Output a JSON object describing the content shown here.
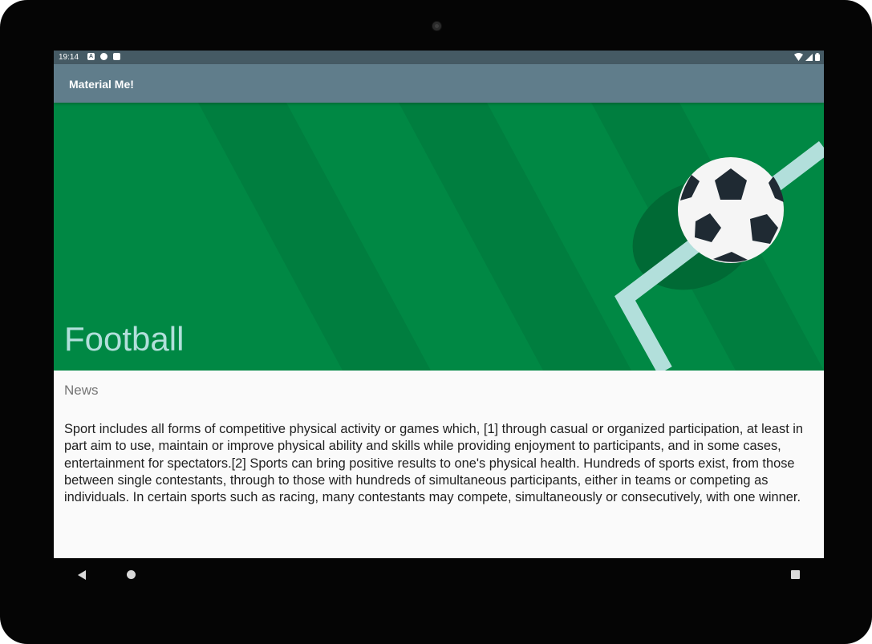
{
  "status_bar": {
    "time": "19:14",
    "left_icons": [
      "a-icon",
      "sync-icon",
      "sd-card-icon"
    ],
    "right_icons": [
      "wifi-icon",
      "cell-signal-icon",
      "battery-icon"
    ]
  },
  "app_bar": {
    "title": "Material Me!"
  },
  "card": {
    "title": "Football",
    "subtitle": "News",
    "details": "Sport includes all forms of competitive physical activity or games which, [1] through casual or organized participation, at least in part aim to use, maintain or improve physical ability and skills while providing enjoyment to participants, and in some cases, entertainment for spectators.[2] Sports can bring positive results to one's physical health. Hundreds of sports exist, from those between single contestants, through to those with hundreds of simultaneous participants, either in teams or competing as individuals. In certain sports such as racing, many contestants may compete, simultaneously or consecutively, with one winner.",
    "image": "football-field-with-ball-image"
  },
  "nav_bar": {
    "buttons": [
      "back-icon",
      "home-icon",
      "recents-icon"
    ]
  },
  "colors": {
    "status_bar": "#455a64",
    "app_bar": "#607d8b",
    "field_green": "#008844",
    "title_text": "#b2dfdb",
    "background": "#fafafa"
  }
}
